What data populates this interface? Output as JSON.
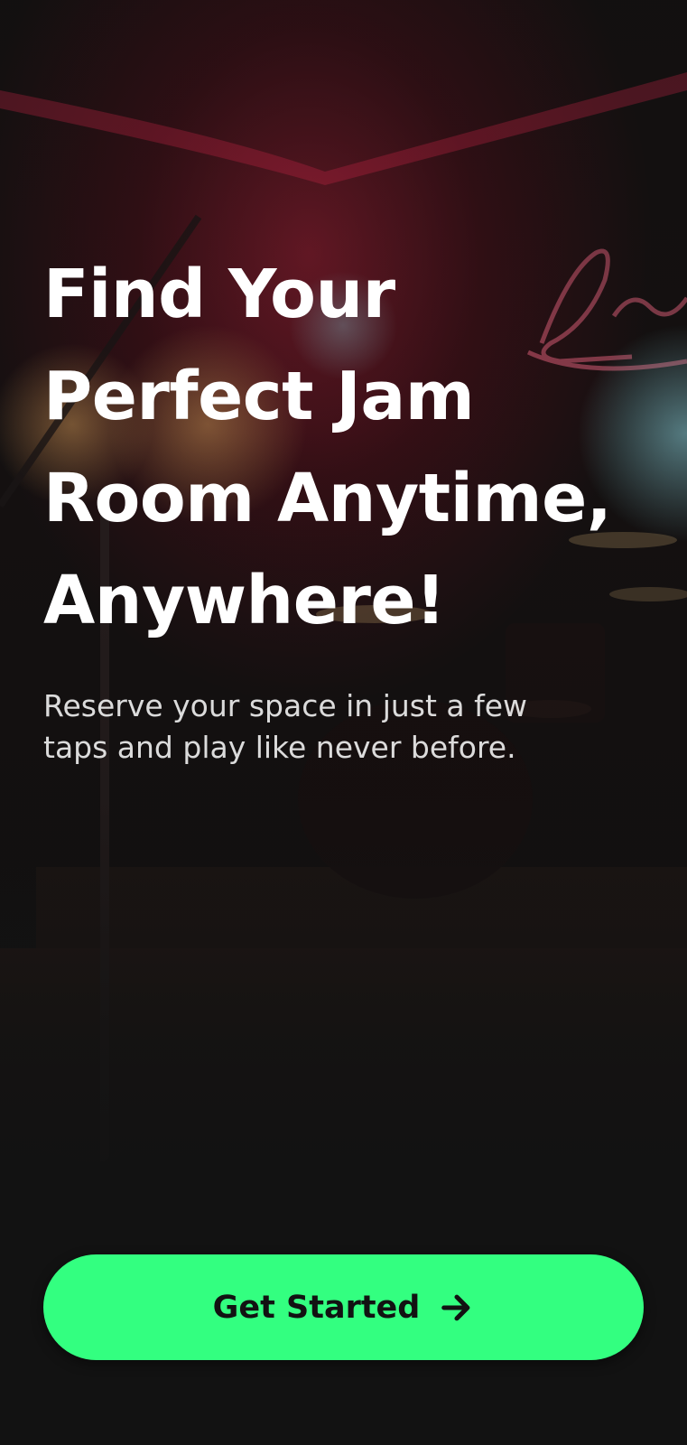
{
  "hero": {
    "headline_lines": [
      "Find Your",
      "Perfect Jam",
      "Room Anytime,",
      "Anywhere!"
    ],
    "subtitle": "Reserve your space in just a few taps and play like never before."
  },
  "cta": {
    "label": "Get Started",
    "icon": "arrow-right-icon",
    "color": "#33ff80"
  },
  "background": {
    "description_icon": "music-stage-photo",
    "neon_color": "#ff3b6b",
    "glow_color": "#8ff5ff"
  }
}
